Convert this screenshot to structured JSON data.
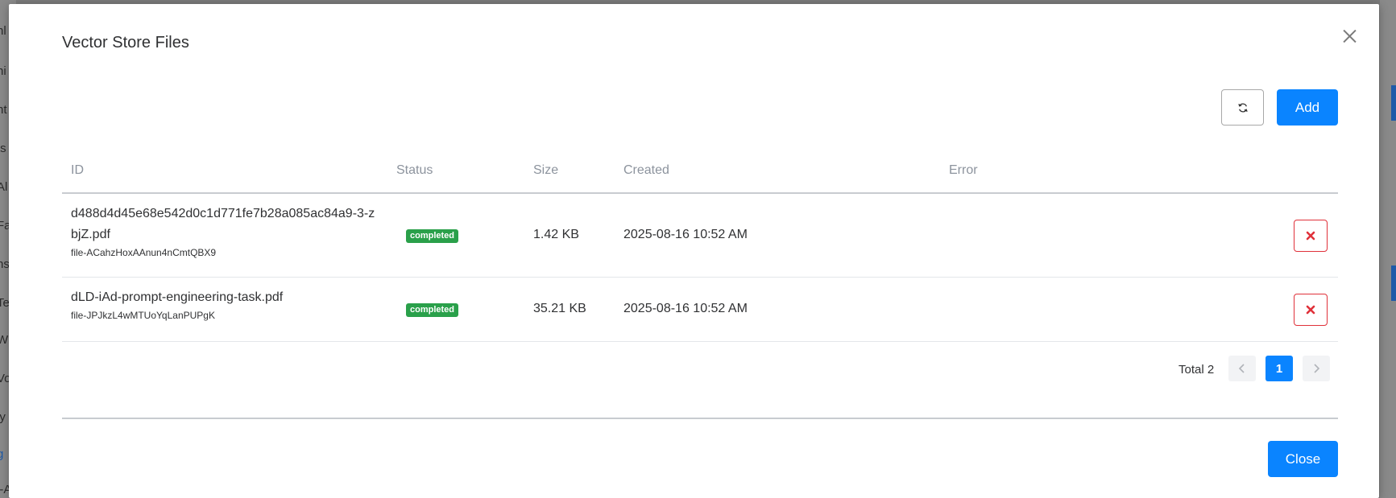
{
  "background": {
    "left_fragments": [
      "hl",
      "ni",
      "nt",
      "ts",
      "Al",
      "Fa",
      "ns",
      "Te",
      "W",
      "Vo",
      "ly",
      "g",
      "i-A"
    ]
  },
  "dialog": {
    "title": "Vector Store Files",
    "close_icon": "close-icon",
    "refresh_icon": "refresh-icon",
    "add_label": "Add",
    "close_label": "Close"
  },
  "table": {
    "columns": [
      "ID",
      "Status",
      "Size",
      "Created",
      "Error"
    ],
    "rows": [
      {
        "name": "d488d4d45e68e542d0c1d771fe7b28a085ac84a9-3-zbjZ.pdf",
        "file_id": "file-ACahzHoxAAnun4nCmtQBX9",
        "status": "completed",
        "size": "1.42 KB",
        "created": "2025-08-16 10:52 AM",
        "error": ""
      },
      {
        "name": "dLD-iAd-prompt-engineering-task.pdf",
        "file_id": "file-JPJkzL4wMTUoYqLanPUPgK",
        "status": "completed",
        "size": "35.21 KB",
        "created": "2025-08-16 10:52 AM",
        "error": ""
      }
    ]
  },
  "pagination": {
    "total_label": "Total 2",
    "current_page": "1",
    "prev_icon": "chevron-left-icon",
    "next_icon": "chevron-right-icon"
  },
  "colors": {
    "primary": "#0a84ff",
    "success": "#2aa04a",
    "danger": "#e0313a"
  }
}
